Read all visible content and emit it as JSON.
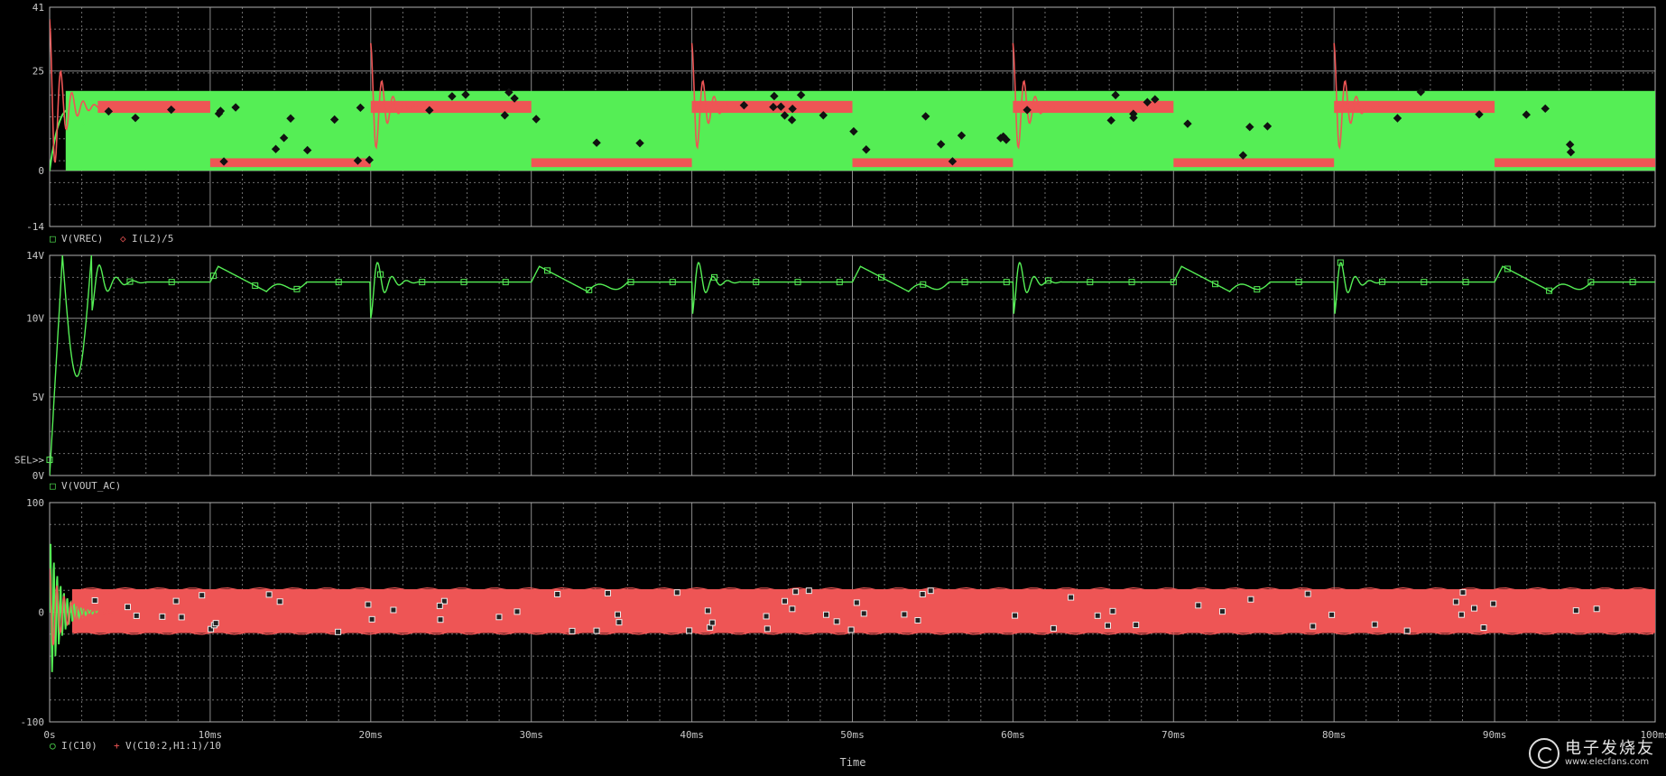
{
  "chart_data": [
    {
      "type": "line",
      "xlim": [
        0,
        100
      ],
      "ylim": [
        -14,
        41
      ],
      "yticks": [
        41,
        25,
        0,
        -14
      ],
      "ytick_labels": [
        "41",
        "25",
        "0",
        "-14"
      ],
      "series": [
        {
          "name": "V(VREC)",
          "color": "#55ee55",
          "marker": "square",
          "note": "rectified voltage, full-wave band between 0 and ~20"
        },
        {
          "name": "I(L2)/5",
          "color": "#ee5555",
          "marker": "diamond",
          "note": "inductor current, alternates ~16 and ~2"
        }
      ],
      "legend": [
        {
          "symbol": "□",
          "label": "V(VREC)",
          "color": "#55ee55"
        },
        {
          "symbol": "◇",
          "label": "I(L2)/5",
          "color": "#ee5555"
        }
      ],
      "high_level": 20,
      "red_high": 16,
      "red_low": 2,
      "switch_times": [
        10,
        20,
        30,
        40,
        50,
        60,
        70,
        80,
        90
      ],
      "spikes_at": [
        20,
        40,
        60,
        80
      ],
      "spike_peak": 32
    },
    {
      "type": "line",
      "xlim": [
        0,
        100
      ],
      "ylim": [
        0,
        14
      ],
      "yticks": [
        14,
        10,
        5,
        0
      ],
      "ytick_labels": [
        "14V",
        "10V",
        "5V",
        "0V"
      ],
      "sel_label": "SEL>>",
      "series": [
        {
          "name": "V(VOUT_AC)",
          "color": "#55ee55",
          "marker": "square"
        }
      ],
      "legend": [
        {
          "symbol": "□",
          "label": "V(VOUT_AC)",
          "color": "#55ee55"
        }
      ],
      "steady_value": 12.3,
      "startup_min": 6.3,
      "ring_at": [
        20,
        40,
        60,
        80
      ],
      "ring_min": 10,
      "bump_at": [
        10,
        30,
        50,
        70,
        90
      ],
      "bump_max": 13.3
    },
    {
      "type": "line",
      "xlim": [
        0,
        100
      ],
      "ylim": [
        -100,
        100
      ],
      "yticks": [
        100,
        0,
        -100
      ],
      "ytick_labels": [
        "100",
        "0",
        "-100"
      ],
      "series": [
        {
          "name": "I(C10)",
          "color": "#55ee55",
          "marker": "circle"
        },
        {
          "name": "V(C10:2,H1:1)/10",
          "color": "#ee5555",
          "marker": "plus"
        }
      ],
      "legend": [
        {
          "symbol": "○",
          "label": "I(C10)",
          "color": "#55ee55"
        },
        {
          "symbol": "+",
          "label": "V(C10:2,H1:1)/10",
          "color": "#ee5555"
        }
      ],
      "band_top": 21,
      "band_bottom": -19,
      "startup_peak": 65,
      "startup_trough": -72
    }
  ],
  "x_ticks": [
    0,
    10,
    20,
    30,
    40,
    50,
    60,
    70,
    80,
    90,
    100
  ],
  "x_tick_labels": [
    "0s",
    "10ms",
    "20ms",
    "30ms",
    "40ms",
    "50ms",
    "60ms",
    "70ms",
    "80ms",
    "90ms",
    "100ms"
  ],
  "x_title": "Time",
  "watermark": {
    "text": "电子发烧友",
    "url": "www.elecfans.com"
  }
}
